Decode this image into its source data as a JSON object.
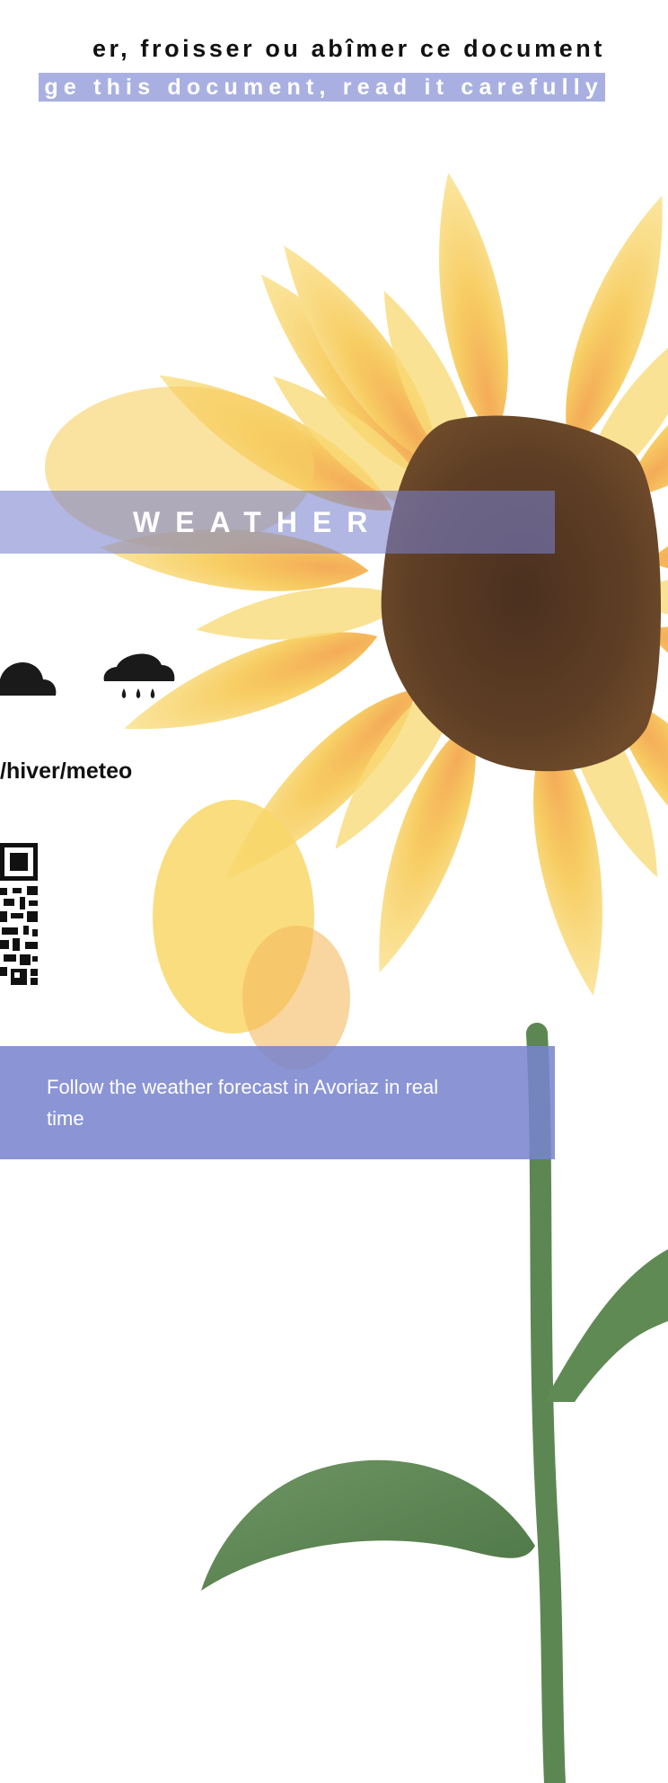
{
  "notice": {
    "french_line": "er, froisser ou abîmer ce document",
    "english_line": "ge this document, read it carefully"
  },
  "weather": {
    "title": "WEATHER",
    "icons": [
      "cloud-icon",
      "rain-cloud-icon"
    ],
    "url_fragment": "/hiver/meteo",
    "qr": "qr-code-icon",
    "info_text": "Follow the weather forecast in Avoriaz in real time"
  },
  "colors": {
    "band": "#7882cd",
    "info_box": "#7884ce",
    "text_dark": "#111111",
    "petal": "#f6cf4a",
    "flower_center": "#5a3a22",
    "stem": "#5d8752"
  }
}
